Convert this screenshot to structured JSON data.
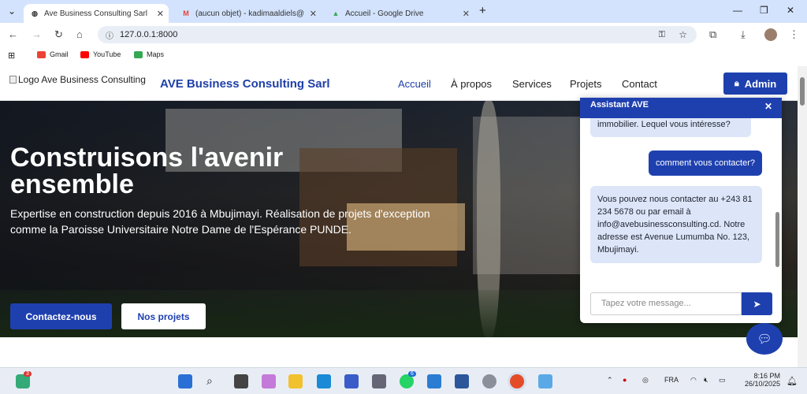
{
  "browser": {
    "tabs": [
      {
        "title": "Ave Business Consulting Sarl",
        "favicon": "globe-icon",
        "active": true
      },
      {
        "title": "(aucun objet) - kadimaaldiels@",
        "favicon": "gmail-icon",
        "active": false
      },
      {
        "title": "Accueil - Google Drive",
        "favicon": "drive-icon",
        "active": false
      }
    ],
    "url": "127.0.0.1:8000",
    "bookmarks": [
      {
        "label": "Gmail",
        "color": "#ea4335"
      },
      {
        "label": "YouTube",
        "color": "#ff0000"
      },
      {
        "label": "Maps",
        "color": "#34a853"
      }
    ]
  },
  "site": {
    "logo_alt": "Logo Ave Business Consulting",
    "brand": "AVE Business Consulting Sarl",
    "nav": [
      {
        "label": "Accueil",
        "active": true
      },
      {
        "label": "À propos",
        "active": false
      },
      {
        "label": "Services",
        "active": false
      },
      {
        "label": "Projets",
        "active": false
      },
      {
        "label": "Contact",
        "active": false
      }
    ],
    "admin_label": "Admin",
    "hero": {
      "title": "Construisons l'avenir ensemble",
      "subtitle": "Expertise en construction depuis 2016 à Mbujimayi. Réalisation de projets d'exception comme la Paroisse Universitaire Notre Dame de l'Espérance PUNDE.",
      "cta_primary": "Contactez-nous",
      "cta_secondary": "Nos projets"
    },
    "colors": {
      "accent": "#1e40af"
    }
  },
  "chat": {
    "title": "Assistant AVE",
    "messages": [
      {
        "from": "bot",
        "text": "immobilier. Lequel vous intéresse?"
      },
      {
        "from": "user",
        "text": "comment vous contacter?"
      },
      {
        "from": "bot",
        "text": "Vous pouvez nous contacter au +243 81 234 5678 ou par email à info@avebusinessconsulting.cd. Notre adresse est Avenue Lumumba No. 123, Mbujimayi."
      }
    ],
    "input_placeholder": "Tapez votre message..."
  },
  "taskbar": {
    "language": "FRA",
    "time": "8:16 PM",
    "date": "26/10/2025",
    "badges": {
      "left_app": "3",
      "whatsapp": "6"
    }
  }
}
